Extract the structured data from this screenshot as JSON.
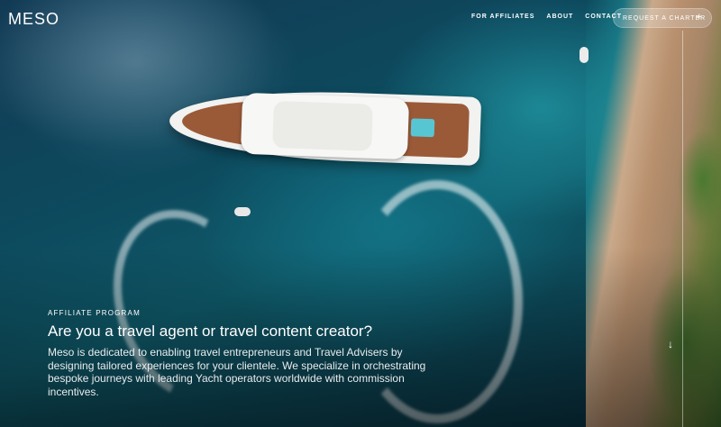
{
  "header": {
    "logo": "MESO",
    "nav": [
      {
        "label": "FOR AFFILIATES"
      },
      {
        "label": "ABOUT"
      },
      {
        "label": "CONTACT"
      }
    ],
    "cta_label": "REQUEST A CHARTER",
    "cta_icon": "plus-icon"
  },
  "hero": {
    "eyebrow": "AFFILIATE PROGRAM",
    "headline": "Are you a travel agent or travel content creator?",
    "body": "Meso is dedicated to enabling travel entrepreneurs and Travel Advisers by designing tailored experiences for your clientele. We specialize in orchestrating bespoke journeys with leading Yacht operators worldwide with commission incentives.",
    "scroll_icon": "arrow-down-icon"
  },
  "colors": {
    "text": "#ffffff",
    "water": "#0f5a6a",
    "shore": "#b8906e"
  }
}
